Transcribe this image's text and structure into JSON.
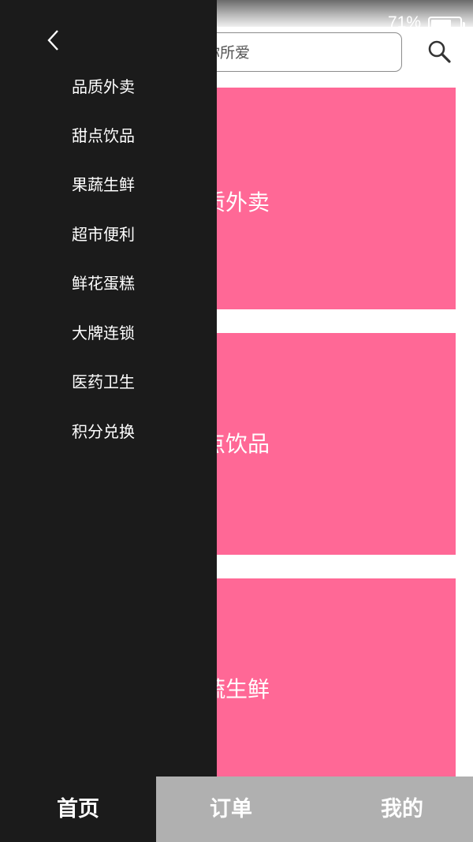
{
  "status_bar": {
    "battery_text": "71%",
    "battery_level": 0.71
  },
  "header": {
    "search_placeholder": "找你所爱"
  },
  "cards": [
    {
      "label": "品质外卖"
    },
    {
      "label": "甜点饮品"
    },
    {
      "label": "果蔬生鲜"
    }
  ],
  "drawer": {
    "items": [
      {
        "label": "品质外卖"
      },
      {
        "label": "甜点饮品"
      },
      {
        "label": "果蔬生鲜"
      },
      {
        "label": "超市便利"
      },
      {
        "label": "鲜花蛋糕"
      },
      {
        "label": "大牌连锁"
      },
      {
        "label": "医药卫生"
      },
      {
        "label": "积分兑换"
      }
    ]
  },
  "tab_bar": {
    "home": "首页",
    "orders": "订单",
    "mine": "我的"
  },
  "colors": {
    "accent_pink": "#ff6896",
    "drawer_bg": "#1b1b1b",
    "tab_bar_bg": "#b0b0b0"
  },
  "icons": [
    "back-icon",
    "search-icon",
    "battery-icon"
  ]
}
